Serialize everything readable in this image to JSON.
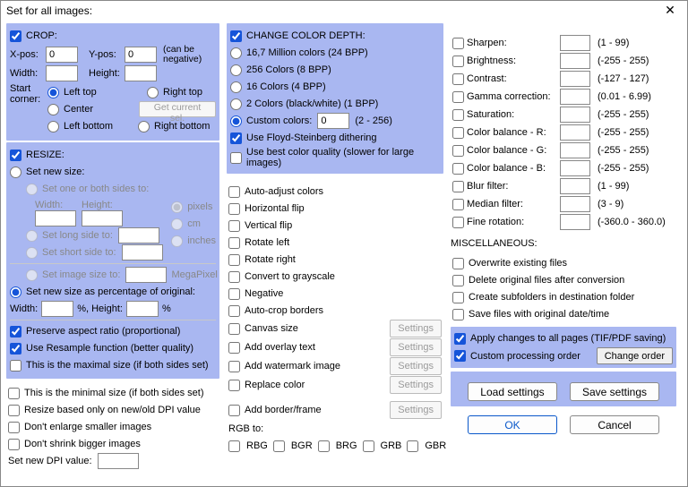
{
  "title": "Set for all images:",
  "crop": {
    "header": "CROP:",
    "xpos_lbl": "X-pos:",
    "xpos": "0",
    "ypos_lbl": "Y-pos:",
    "ypos": "0",
    "width_lbl": "Width:",
    "width": "",
    "height_lbl": "Height:",
    "height": "",
    "note": "(can be negative)",
    "start_lbl": "Start corner:",
    "lt": "Left top",
    "rt": "Right top",
    "c": "Center",
    "lb": "Left bottom",
    "rb": "Right bottom",
    "getsel": "Get current sel."
  },
  "resize": {
    "header": "RESIZE:",
    "newsize": "Set new size:",
    "oneorboth": "Set one or both sides to:",
    "width_lbl": "Width:",
    "height_lbl": "Height:",
    "long": "Set long side to:",
    "short": "Set short side to:",
    "unit_px": "pixels",
    "unit_cm": "cm",
    "unit_in": "inches",
    "imgsize": "Set image size to:",
    "mp": "MegaPixel",
    "pct": "Set new size as percentage of original:",
    "pct_w_lbl": "Width:",
    "pct_h_lbl": "%, Height:",
    "pct_suffix": "%",
    "aspect": "Preserve aspect ratio (proportional)",
    "resample": "Use Resample function (better quality)",
    "max": "This is the maximal size (if both sides set)",
    "min": "This is the minimal size (if both sides set)",
    "dpi_based": "Resize based only on new/old DPI value",
    "noenlarge": "Don't enlarge smaller images",
    "noshrink": "Don't shrink bigger images",
    "setdpi": "Set new DPI value:"
  },
  "depth": {
    "header": "CHANGE COLOR DEPTH:",
    "c167m": "16,7 Million colors (24 BPP)",
    "c256": "256 Colors (8 BPP)",
    "c16": "16 Colors (4 BPP)",
    "c2": "2 Colors (black/white) (1 BPP)",
    "custom": "Custom colors:",
    "custom_val": "0",
    "custom_range": "(2 - 256)",
    "dither": "Use Floyd-Steinberg dithering",
    "best": "Use best color quality (slower for large images)"
  },
  "ops": {
    "autoadj": "Auto-adjust colors",
    "hflip": "Horizontal flip",
    "vflip": "Vertical flip",
    "rotl": "Rotate left",
    "rotr": "Rotate right",
    "gray": "Convert to grayscale",
    "neg": "Negative",
    "autocrop": "Auto-crop borders",
    "canvas": "Canvas size",
    "overlay": "Add overlay text",
    "wm": "Add watermark image",
    "replace": "Replace color",
    "border": "Add border/frame",
    "settings": "Settings",
    "rgbto": "RGB to:",
    "rbg": "RBG",
    "bgr": "BGR",
    "brg": "BRG",
    "grb": "GRB",
    "gbr": "GBR"
  },
  "fx": {
    "sharpen": "Sharpen:",
    "sharpen_r": "(1  -  99)",
    "bright": "Brightness:",
    "bright_r": "(-255  -  255)",
    "contrast": "Contrast:",
    "contrast_r": "(-127  -  127)",
    "gamma": "Gamma correction:",
    "gamma_r": "(0.01  -  6.99)",
    "sat": "Saturation:",
    "sat_r": "(-255  -  255)",
    "cbr": "Color balance - R:",
    "cbr_r": "(-255  -  255)",
    "cbg": "Color balance - G:",
    "cbg_r": "(-255  -  255)",
    "cbb": "Color balance - B:",
    "cbb_r": "(-255  -  255)",
    "blur": "Blur filter:",
    "blur_r": "(1  -  99)",
    "median": "Median filter:",
    "median_r": "(3  -  9)",
    "finerot": "Fine rotation:",
    "finerot_r": "(-360.0  -  360.0)"
  },
  "misc": {
    "header": "MISCELLANEOUS:",
    "overwrite": "Overwrite existing files",
    "delete": "Delete original files after conversion",
    "subfolders": "Create subfolders in destination folder",
    "origdate": "Save files with original date/time",
    "allpages": "Apply changes to all pages (TIF/PDF saving)",
    "order": "Custom processing order",
    "change_order": "Change order"
  },
  "buttons": {
    "load": "Load settings",
    "save": "Save settings",
    "ok": "OK",
    "cancel": "Cancel"
  }
}
